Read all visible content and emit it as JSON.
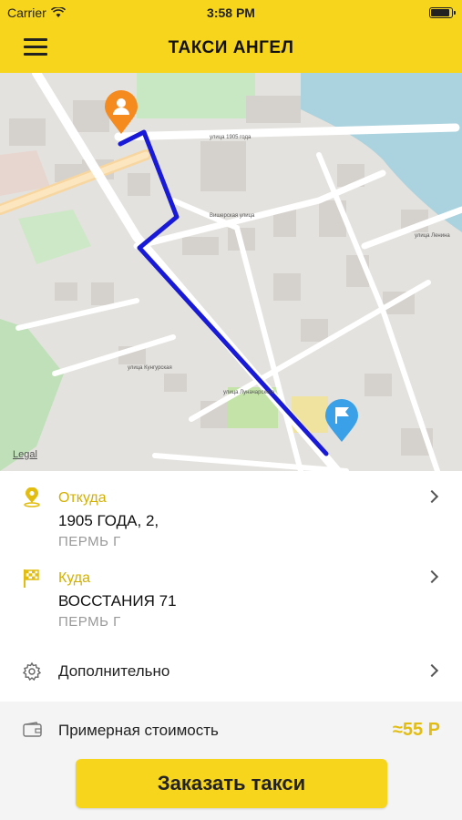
{
  "status_bar": {
    "carrier": "Carrier",
    "time": "3:58 PM"
  },
  "header": {
    "title": "ТАКСИ АНГЕЛ"
  },
  "map": {
    "legal_link": "Legal",
    "street_labels": [
      "улица 1905 года",
      "Вишерская улица",
      "улица Ленина",
      "улица Кунгурская",
      "улица Луначарского"
    ]
  },
  "route": {
    "from": {
      "label": "Откуда",
      "address": "1905 ГОДА, 2,",
      "city": "ПЕРМЬ Г"
    },
    "to": {
      "label": "Куда",
      "address": "ВОССТАНИЯ 71",
      "city": "ПЕРМЬ Г"
    },
    "extra": {
      "label": "Дополнительно"
    }
  },
  "price": {
    "label": "Примерная стоимость",
    "value": "≈55 Р"
  },
  "order_button": {
    "label": "Заказать такси"
  },
  "colors": {
    "brand_yellow": "#f7d51d",
    "accent_gold": "#d3b000",
    "route_blue": "#1919d8",
    "origin_pin": "#f58a1f",
    "destination_pin": "#3aa0e8"
  },
  "icons": {
    "origin_marker": "person-pin-icon",
    "destination_marker": "flag-pin-icon",
    "from_icon": "location-pin-icon",
    "to_icon": "checkered-flag-icon",
    "extra_icon": "gear-icon",
    "price_icon": "wallet-icon"
  }
}
